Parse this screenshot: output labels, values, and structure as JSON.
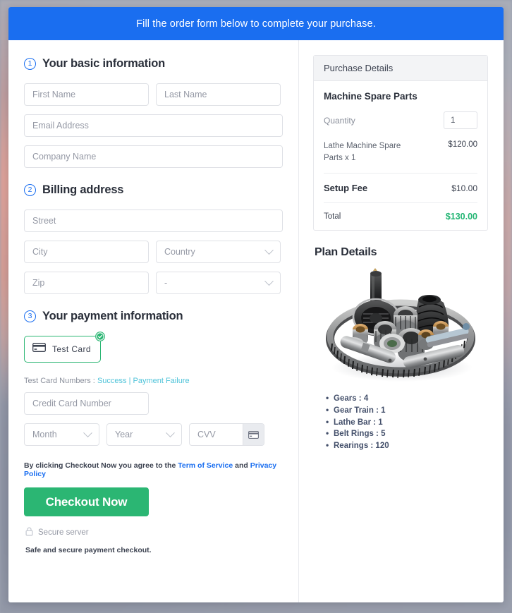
{
  "banner": {
    "text": "Fill the order form below to complete your purchase."
  },
  "steps": [
    {
      "num": "1",
      "title": "Your basic information"
    },
    {
      "num": "2",
      "title": "Billing address"
    },
    {
      "num": "3",
      "title": "Your payment information"
    }
  ],
  "basic": {
    "first_name": "First Name",
    "last_name": "Last Name",
    "email": "Email Address",
    "company": "Company Name"
  },
  "billing": {
    "street": "Street",
    "city": "City",
    "country": "Country",
    "zip": "Zip",
    "state": "-"
  },
  "payment": {
    "method_label": "Test  Card",
    "method_icon": "credit-card-icon",
    "selected_badge": "check-circle-icon",
    "testnums_prefix": "Test Card Numbers :",
    "link_success": "Success",
    "link_separator": "|",
    "link_failure": "Payment Failure",
    "card_number": "Credit Card Number",
    "month": "Month",
    "year": "Year",
    "cvv": "CVV",
    "cvv_icon": "credit-card-icon"
  },
  "footer": {
    "terms_prefix": "By clicking Checkout Now you agree to the",
    "terms_link": "Term of Service",
    "terms_and": "and",
    "privacy_link": "Privacy Policy",
    "checkout_label": "Checkout Now",
    "secure_label": "Secure server",
    "secure_icon": "lock-icon",
    "safe_note": "Safe and secure payment checkout."
  },
  "purchase": {
    "header": "Purchase Details",
    "product": "Machine Spare Parts",
    "quantity_label": "Quantity",
    "quantity_value": "1",
    "line_item": "Lathe Machine Spare Parts x 1",
    "line_amount": "$120.00",
    "fee_label": "Setup Fee",
    "fee_amount": "$10.00",
    "total_label": "Total",
    "total_amount": "$130.00"
  },
  "plan": {
    "title": "Plan Details",
    "image_alt": "machine-spare-parts-photo",
    "specs": [
      "Gears : 4",
      "Gear Train : 1",
      "Lathe Bar : 1",
      "Belt Rings : 5",
      "Rearings : 120"
    ]
  },
  "colors": {
    "banner_blue": "#1a6ef0",
    "accent_green": "#2bb673",
    "total_green": "#22b573",
    "link_cyan": "#4ec3d9",
    "link_blue": "#1a6ef0"
  }
}
